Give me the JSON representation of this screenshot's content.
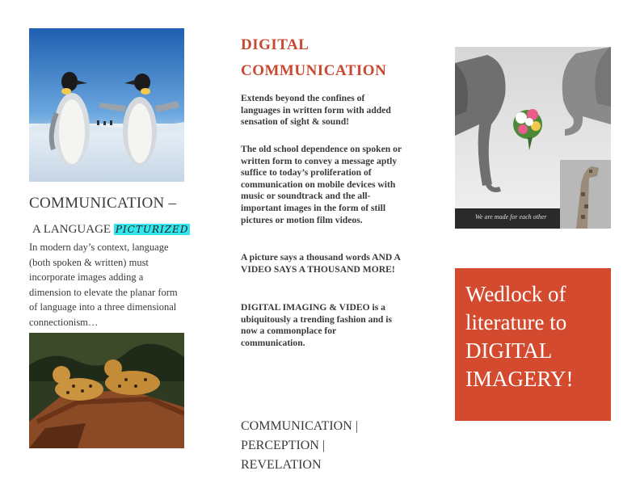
{
  "left": {
    "heading": "COMMUNICATION –",
    "language_prefix": "A LANGUAGE",
    "language_highlight": "PICTURIZED",
    "body": "In modern day’s context, language (both spoken & written)  must incorporate images adding a dimension to elevate the planar form of language into a three dimensional connectionism…"
  },
  "middle": {
    "title_line1": "DIGITAL",
    "title_line2": "COMMUNICATION",
    "p1": "Extends beyond the confines of languages in written form with added sensation of sight & sound!",
    "p2": "The old school dependence on spoken or written form to convey a message aptly suffice to today’s proliferation of communication on mobile devices with music or soundtrack and the all-important images in the form of still pictures or motion film videos.",
    "p3": "A picture says a thousand words AND A VIDEO SAYS A THOUSAND MORE!",
    "p4": "DIGITAL IMAGING & VIDEO is a ubiquitously a trending fashion and is now a commonplace for communication.",
    "footer": "COMMUNICATION | PERCEPTION | REVELATION"
  },
  "right": {
    "photo_caption": "We are made for each other",
    "box_text": "Wedlock of literature to DIGITAL IMAGERY!"
  },
  "colors": {
    "accent_red": "#c8492f",
    "box_orange": "#d44a2e",
    "highlight_cyan": "#33e6ee"
  }
}
